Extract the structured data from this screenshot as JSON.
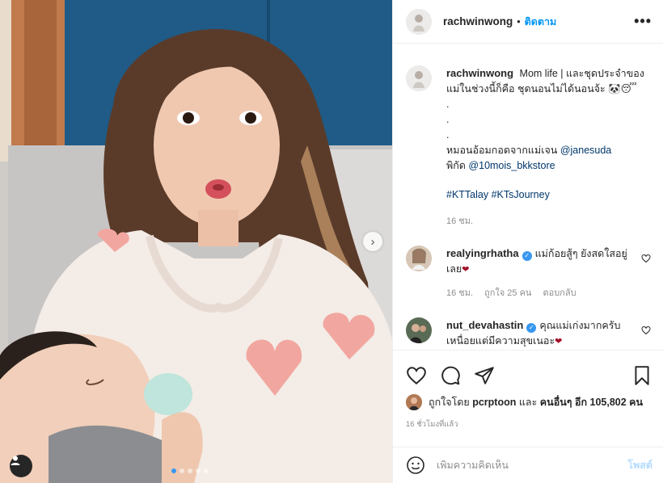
{
  "header": {
    "username": "rachwinwong",
    "separator": "•",
    "follow_label": "ติดตาม",
    "more_label": "•••"
  },
  "caption": {
    "username": "rachwinwong",
    "lines": [
      "Mom life | และชุดประจำของ",
      "แม่ในช่วงนี้ก็คือ ชุดนอนไม่ได้นอนจ้ะ 🐼😴",
      ".",
      ".",
      ".",
      "หมอนอ้อมกอดจากแม่เจน",
      "พิกัด"
    ],
    "mention_1": "@janesuda",
    "mention_2": "@10mois_bkkstore",
    "hashtags": "#KTTalay #KTsJourney",
    "time": "16 ชม."
  },
  "comments": [
    {
      "username": "realyingrhatha",
      "verified": true,
      "text_1": "แม่ก้อยสู้ๆ ยังสดใสอยู่",
      "text_2": "เลย",
      "heart": "❤",
      "time": "16 ชม.",
      "likes": "ถูกใจ 25 คน",
      "reply": "ตอบกลับ"
    },
    {
      "username": "nut_devahastin",
      "verified": true,
      "text_1": "คุณแม่เก่งมากครับ",
      "text_2": "เหนื่อยแต่มีความสุขเนอะ",
      "heart": "❤"
    }
  ],
  "likes": {
    "prefix": "ถูกใจโดย",
    "first_user": "pcrptoon",
    "middle": "และ",
    "others": "คนอื่นๆ อีก 105,802 คน"
  },
  "timestamp": "16 ชั่วโมงที่แล้ว",
  "add_comment": {
    "placeholder": "เพิ่มความคิดเห็น",
    "post_label": "โพสต์"
  },
  "carousel": {
    "dot_count": 5,
    "active_index": 0
  },
  "icons": {
    "like": "heart-icon",
    "comment": "comment-icon",
    "share": "paper-plane-icon",
    "save": "bookmark-icon",
    "emoji": "smiley-icon",
    "next": "chevron-right-icon",
    "tag": "user-tag-icon"
  },
  "colors": {
    "link": "#00376b",
    "follow": "#0095f6",
    "verified": "#3897f0",
    "post_disabled": "#b3dbff",
    "muted": "#8e8e8e"
  }
}
